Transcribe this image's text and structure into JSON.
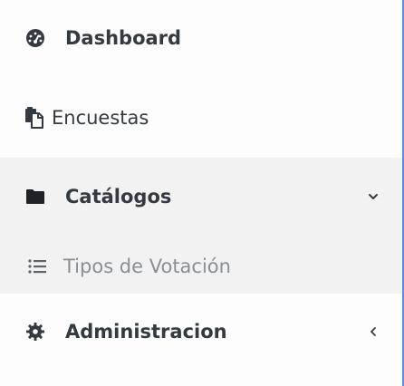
{
  "sidebar": {
    "items": [
      {
        "label": "Dashboard",
        "icon": "tachometer-icon"
      },
      {
        "label": "Encuestas",
        "icon": "copy-documents-icon"
      },
      {
        "label": "Catálogos",
        "icon": "folder-icon",
        "state": "expanded"
      },
      {
        "label": "Tipos de Votación",
        "icon": "list-icon"
      },
      {
        "label": "Administracion",
        "icon": "gear-icon",
        "state": "collapsed"
      }
    ]
  },
  "colors": {
    "text": "#343a40",
    "muted_text": "#8a8f94",
    "group_background": "#f2f2f2",
    "window_border": "#5b8fd6"
  }
}
